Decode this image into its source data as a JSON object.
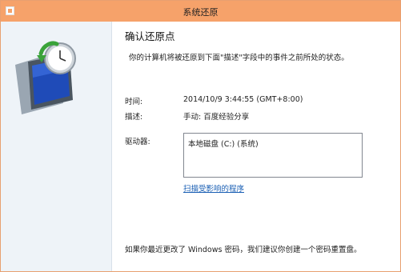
{
  "window": {
    "title": "系统还原"
  },
  "page": {
    "heading": "确认还原点",
    "description": "你的计算机将被还原到下面\"描述\"字段中的事件之前所处的状态。"
  },
  "details": {
    "time_label": "时间:",
    "time_value": "2014/10/9 3:44:55 (GMT+8:00)",
    "desc_label": "描述:",
    "desc_value": "手动: 百度经验分享",
    "drives_label": "驱动器:",
    "drives": [
      "本地磁盘 (C:) (系统)"
    ]
  },
  "links": {
    "scan_programs": "扫描受影响的程序"
  },
  "footer": {
    "password_note": "如果你最近更改了 Windows 密码，我们建议你创建一个密码重置盘。"
  },
  "icons": {
    "app": "system-restore-app-icon",
    "hero": "system-restore-icon"
  },
  "colors": {
    "titlebar": "#f6a26a",
    "sidebar": "#eef3f8",
    "link": "#1a5fb4"
  }
}
